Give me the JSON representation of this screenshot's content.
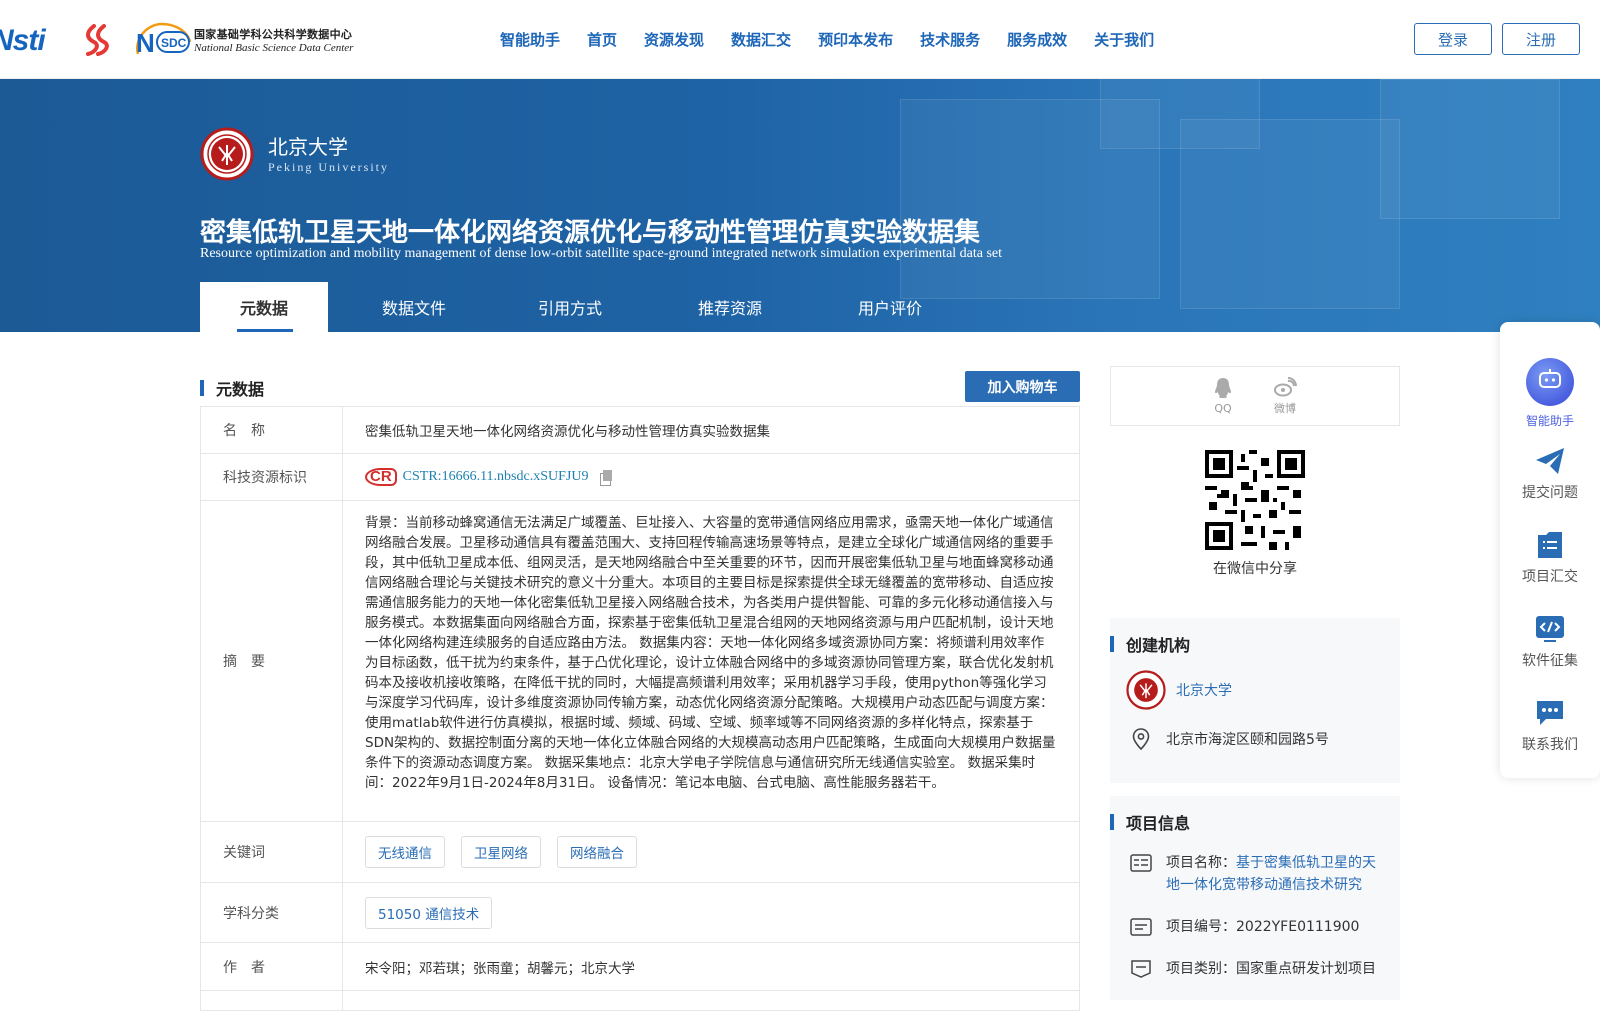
{
  "header": {
    "logo_nsti": "Nsti",
    "logo_nsdc_cn": "国家基础学科公共科学数据中心",
    "logo_nsdc_en": "National Basic Science Data Center",
    "nav": [
      "智能助手",
      "首页",
      "资源发现",
      "数据汇交",
      "预印本发布",
      "技术服务",
      "服务成效",
      "关于我们"
    ],
    "login_label": "登录",
    "register_label": "注册",
    "accent_color": "#1e66b8"
  },
  "banner": {
    "institution_cn": "北京大学",
    "institution_en": "Peking University",
    "title_cn": "密集低轨卫星天地一体化网络资源优化与移动性管理仿真实验数据集",
    "title_en": "Resource optimization and mobility management of dense low-orbit satellite space-ground integrated network simulation experimental data set",
    "tabs": [
      "元数据",
      "数据文件",
      "引用方式",
      "推荐资源",
      "用户评价"
    ],
    "active_tab": "元数据"
  },
  "metadata": {
    "section_title": "元数据",
    "cart_button": "加入购物车",
    "rows": {
      "name_label": "名　称",
      "name_value": "密集低轨卫星天地一体化网络资源优化与移动性管理仿真实验数据集",
      "id_label": "科技资源标识",
      "id_badge": "CSTR",
      "id_value": "CSTR:16666.11.nbsdc.xSUFJU9",
      "abstract_label": "摘　要",
      "abstract_value": "背景：当前移动蜂窝通信无法满足广域覆盖、巨址接入、大容量的宽带通信网络应用需求，亟需天地一体化广域通信网络融合发展。卫星移动通信具有覆盖范围大、支持回程传输高速场景等特点，是建立全球化广域通信网络的重要手段，其中低轨卫星成本低、组网灵活，是天地网络融合中至关重要的环节，因而开展密集低轨卫星与地面蜂窝移动通信网络融合理论与关键技术研究的意义十分重大。本项目的主要目标是探索提供全球无缝覆盖的宽带移动、自适应按需通信服务能力的天地一体化密集低轨卫星接入网络融合技术，为各类用户提供智能、可靠的多元化移动通信接入与服务模式。本数据集面向网络融合方面，探索基于密集低轨卫星混合组网的天地网络资源与用户匹配机制，设计天地一体化网络构建连续服务的自适应路由方法。 数据集内容：天地一体化网络多域资源协同方案：将频谱利用效率作为目标函数，低干扰为约束条件，基于凸优化理论，设计立体融合网络中的多域资源协同管理方案，联合优化发射机码本及接收机接收策略，在降低干扰的同时，大幅提高频谱利用效率；采用机器学习手段，使用python等强化学习与深度学习代码库，设计多维度资源协同传输方案，动态优化网络资源分配策略。大规模用户动态匹配与调度方案：使用matlab软件进行仿真模拟，根据时域、频域、码域、空域、频率域等不同网络资源的多样化特点，探索基于SDN架构的、数据控制面分离的天地一体化立体融合网络的大规模高动态用户匹配策略，生成面向大规模用户数据量条件下的资源动态调度方案。 数据采集地点：北京大学电子学院信息与通信研究所无线通信实验室。 数据采集时间：2022年9月1日-2024年8月31日。 设备情况：笔记本电脑、台式电脑、高性能服务器若干。",
      "keywords_label": "关键词",
      "keywords": [
        "无线通信",
        "卫星网络",
        "网络融合"
      ],
      "subject_label": "学科分类",
      "subject_value": "51050 通信技术",
      "authors_label": "作　者",
      "authors_value": "宋令阳；邓若琪；张雨童；胡馨元；北京大学"
    }
  },
  "sidebar": {
    "share_qq": "QQ",
    "share_weibo": "微博",
    "qr_caption": "在微信中分享",
    "creator_title": "创建机构",
    "creator_name": "北京大学",
    "creator_address": "北京市海淀区颐和园路5号",
    "project_title": "项目信息",
    "project_name_label": "项目名称：",
    "project_name_value": "基于密集低轨卫星的天地一体化宽带移动通信技术研究",
    "project_no": "项目编号：2022YFE0111900",
    "project_type": "项目类别：国家重点研发计划项目"
  },
  "float_menu": {
    "items": [
      "智能助手",
      "提交问题",
      "项目汇交",
      "软件征集",
      "联系我们"
    ]
  }
}
